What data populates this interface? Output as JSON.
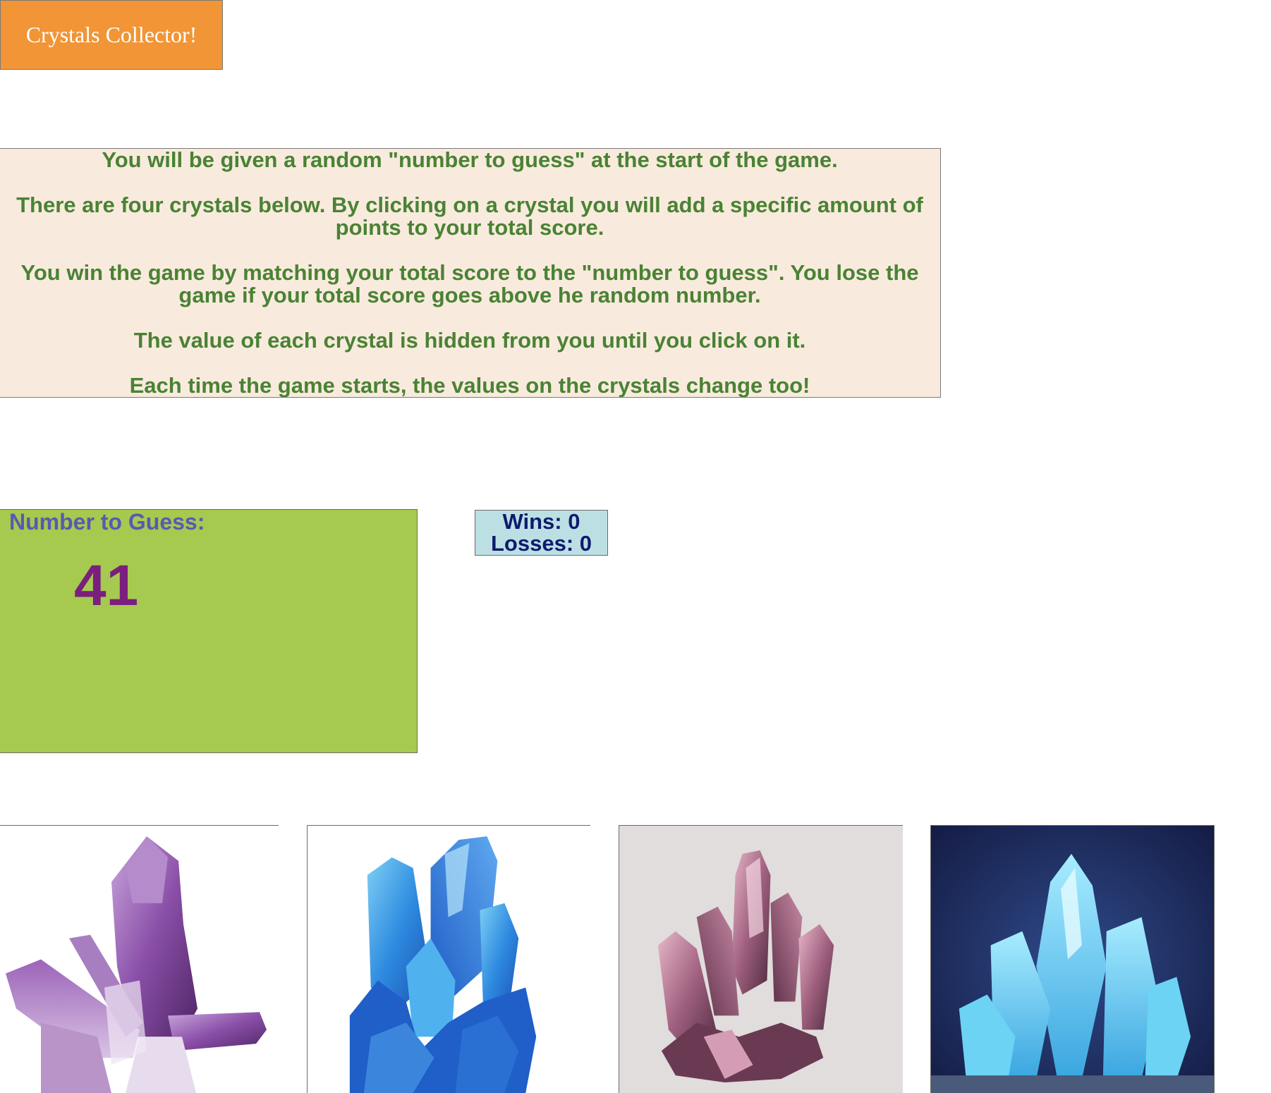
{
  "header": {
    "title": "Crystals Collector!"
  },
  "instructions": [
    "You will be given a random \"number to guess\" at the start of the game.",
    "There are four crystals below. By clicking on a crystal you will add a specific amount of points to your total score.",
    "You win the game by matching your total score to the \"number to guess\". You lose the game if your total score goes above he random number.",
    "The value of each crystal is hidden from you until you click on it.",
    "Each time the game starts, the values on the crystals change too!"
  ],
  "guess": {
    "label": "Number to Guess:",
    "value": "41"
  },
  "score": {
    "wins_label": "Wins: 0",
    "losses_label": "Losses: 0"
  },
  "crystals": [
    {
      "icon": "purple-amethyst-crystal-icon"
    },
    {
      "icon": "blue-crystal-cluster-icon"
    },
    {
      "icon": "pink-crystal-cluster-icon"
    },
    {
      "icon": "glowing-ice-crystal-icon"
    }
  ],
  "colors": {
    "title_bg": "#f19536",
    "instructions_bg": "#f8ebdd",
    "instructions_text": "#4a8234",
    "guess_bg": "#a6c94f",
    "guess_label": "#5b58b3",
    "guess_number": "#7a1f7e",
    "score_bg": "#bcdfe4",
    "score_text": "#0e1a6f"
  }
}
